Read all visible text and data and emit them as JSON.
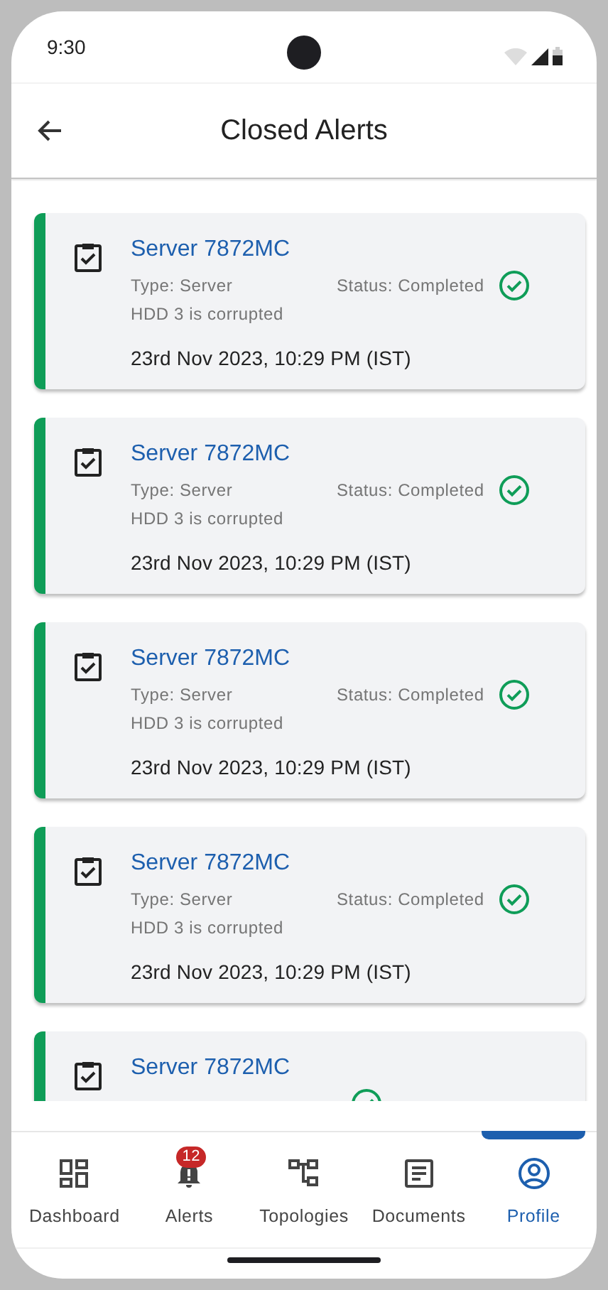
{
  "status_bar": {
    "time": "9:30"
  },
  "header": {
    "title": "Closed Alerts"
  },
  "alerts": [
    {
      "title": "Server 7872MC",
      "type": "Type: Server",
      "status": "Status: Completed",
      "completed": true,
      "description": "HDD 3 is corrupted",
      "datetime": "23rd Nov 2023, 10:29 PM (IST)"
    },
    {
      "title": "Server 7872MC",
      "type": "Type: Server",
      "status": "Status: Completed",
      "completed": true,
      "description": "HDD 3 is corrupted",
      "datetime": "23rd Nov 2023, 10:29 PM (IST)"
    },
    {
      "title": "Server 7872MC",
      "type": "Type: Server",
      "status": "Status: Completed",
      "completed": true,
      "description": "HDD 3 is corrupted",
      "datetime": "23rd Nov 2023, 10:29 PM (IST)"
    },
    {
      "title": "Server 7872MC",
      "type": "Type: Server",
      "status": "Status: Completed",
      "completed": true,
      "description": "HDD 3 is corrupted",
      "datetime": "23rd Nov 2023, 10:29 PM (IST)"
    },
    {
      "title": "Server 7872MC",
      "completed": true
    }
  ],
  "bottom_nav": [
    {
      "label": "Dashboard",
      "selected": false
    },
    {
      "label": "Alerts",
      "selected": false,
      "badge": "12"
    },
    {
      "label": "Topologies",
      "selected": false
    },
    {
      "label": "Documents",
      "selected": false
    },
    {
      "label": "Profile",
      "selected": true
    }
  ]
}
